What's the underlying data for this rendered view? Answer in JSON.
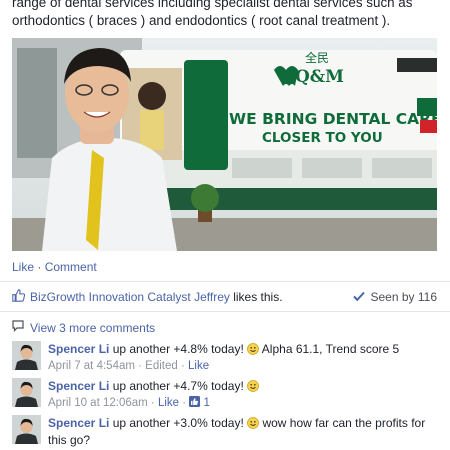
{
  "post": {
    "text": "range of dental services including specialist dental services such as orthodontics ( braces ) and endodontics ( root canal treatment ).",
    "image": {
      "van_logo_chinese": "全民",
      "van_logo_brand": "Q&M",
      "van_slogan_line1": "WE BRING DENTAL CARE",
      "van_slogan_line2": "CLOSER TO YOU",
      "accent_color": "#0f6b3a"
    }
  },
  "actions": {
    "like": "Like",
    "separator": " · ",
    "comment": "Comment"
  },
  "likes": {
    "icon": "thumbs-up-icon",
    "name": "BizGrowth Innovation Catalyst Jeffrey",
    "suffix": " likes this."
  },
  "seen": {
    "icon": "check-icon",
    "label": "Seen by",
    "count": "116"
  },
  "view_more": {
    "icon": "comment-bubble-icon",
    "label": "View 3 more comments"
  },
  "comments": [
    {
      "author": "Spencer Li",
      "text_before": " up another +4.8% today! ",
      "text_after": " Alpha 61.1, Trend score 5",
      "timestamp": "April 7 at 4:54am",
      "edited": "Edited",
      "like": "Like"
    },
    {
      "author": "Spencer Li",
      "text_before": " up another +4.7% today! ",
      "text_after": "",
      "timestamp": "April 10 at 12:06am",
      "like": "Like",
      "like_count": "1"
    },
    {
      "author": "Spencer Li",
      "text_before": " up another +3.0% today! ",
      "text_after": " wow how far can the profits for this go?"
    }
  ]
}
